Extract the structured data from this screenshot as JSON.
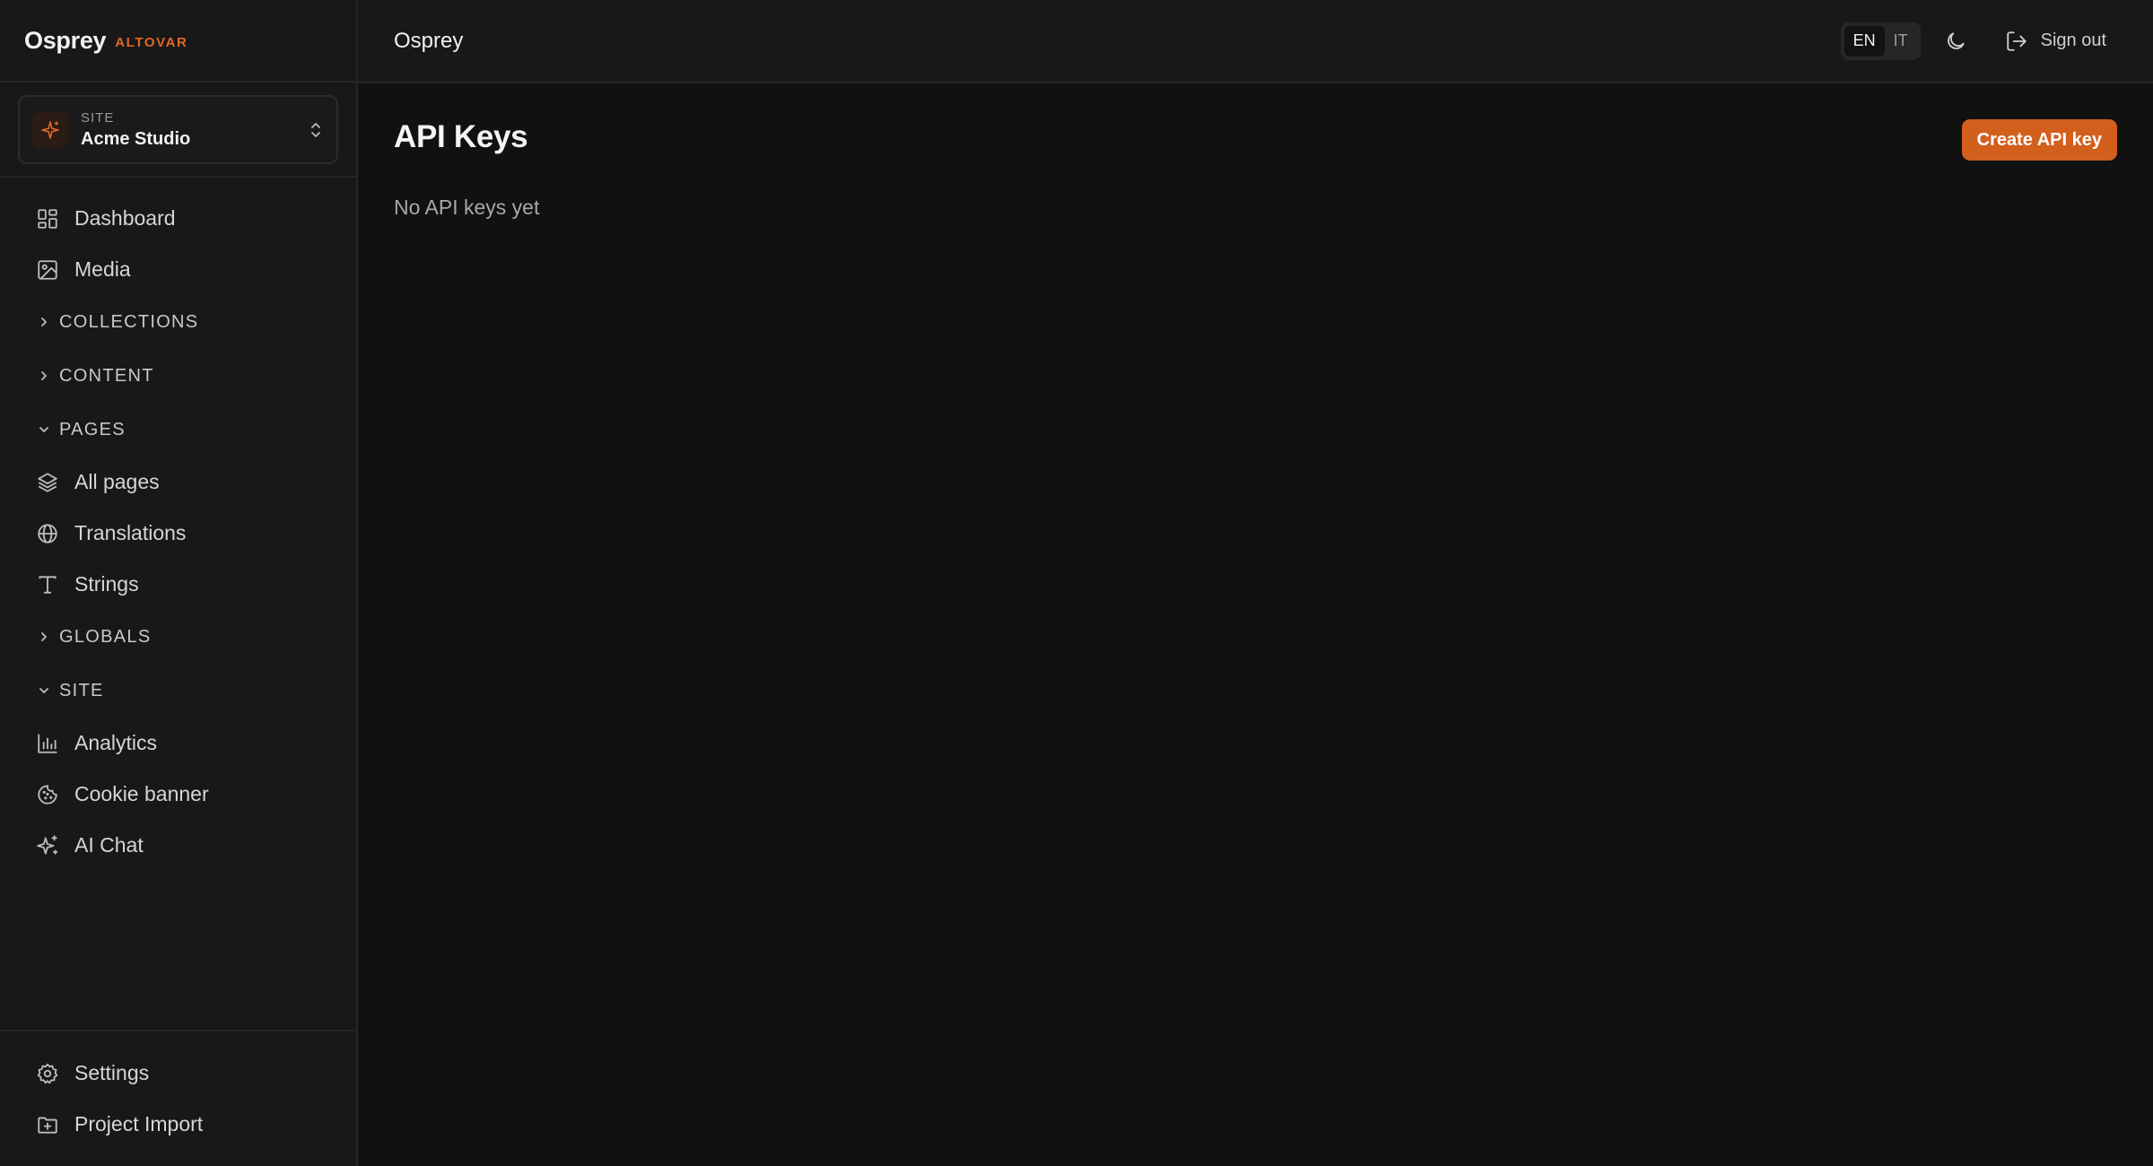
{
  "brand": {
    "name": "Osprey",
    "tag": "ALTOVAR"
  },
  "site_switcher": {
    "label": "SITE",
    "name": "Acme Studio",
    "icon": "sparkle-icon"
  },
  "sidebar": {
    "dashboard": "Dashboard",
    "media": "Media",
    "collections": "COLLECTIONS",
    "content": "CONTENT",
    "pages": "PAGES",
    "all_pages": "All pages",
    "translations": "Translations",
    "strings": "Strings",
    "globals": "GLOBALS",
    "site": "SITE",
    "analytics": "Analytics",
    "cookie_banner": "Cookie banner",
    "ai_chat": "AI Chat",
    "settings": "Settings",
    "project_import": "Project Import"
  },
  "topbar": {
    "title": "Osprey",
    "lang_en": "EN",
    "lang_it": "IT",
    "active_lang": "EN",
    "sign_out": "Sign out"
  },
  "main": {
    "title": "API Keys",
    "create_button": "Create API key",
    "empty_message": "No API keys yet"
  },
  "colors": {
    "accent": "#d35f1d",
    "brand_tag": "#e2662a",
    "background": "#111111",
    "sidebar": "#181818"
  }
}
